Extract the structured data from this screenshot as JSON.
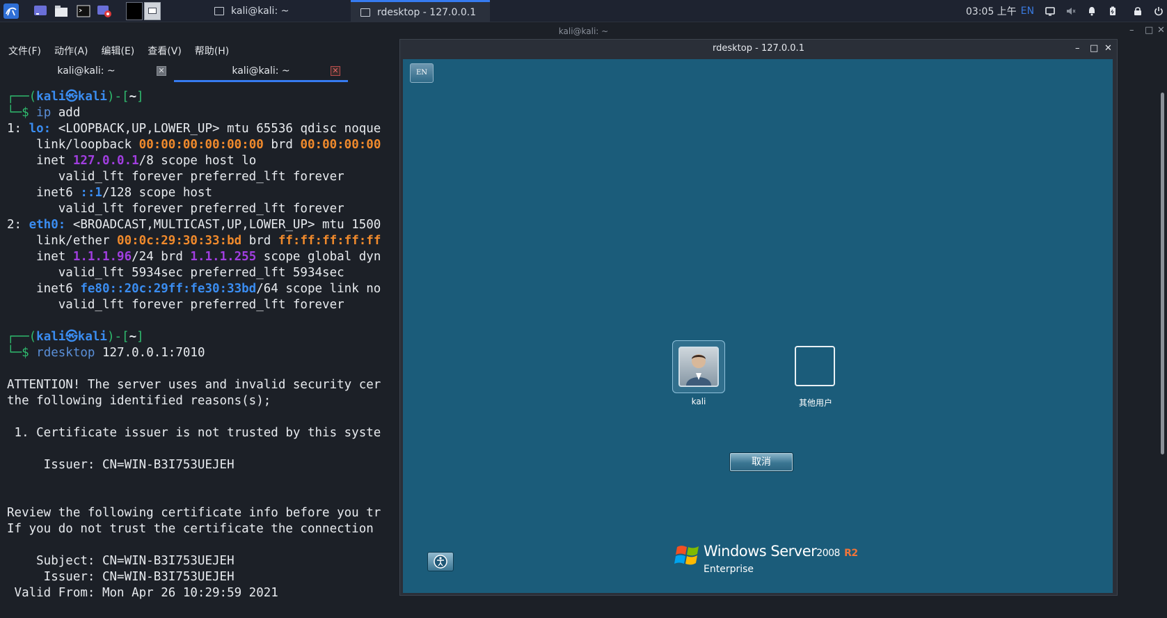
{
  "taskbar": {
    "tasks": [
      {
        "label": "kali@kali: ~"
      },
      {
        "label": "rdesktop - 127.0.0.1"
      }
    ],
    "clock": "03:05 上午",
    "keyboard_layout": "EN"
  },
  "terminal": {
    "window_title": "kali@kali: ~",
    "menu": [
      "文件(F)",
      "动作(A)",
      "编辑(E)",
      "查看(V)",
      "帮助(H)"
    ],
    "tabs": [
      {
        "label": "kali@kali: ~",
        "active": false
      },
      {
        "label": "kali@kali: ~",
        "active": true
      }
    ],
    "lines": {
      "p1_open": "┌──(",
      "p1_user": "kali㉿kali",
      "p1_mid": ")-[",
      "p1_dir": "~",
      "p1_close": "]",
      "p1_prompt": "└─$ ",
      "cmd1_a": "ip",
      "cmd1_b": " add",
      "l1_a": "1: ",
      "l1_if": "lo:",
      "l1_b": " <LOOPBACK,UP,LOWER_UP> mtu 65536 qdisc noque",
      "l2_a": "    link/loopback ",
      "l2_mac": "00:00:00:00:00:00",
      "l2_b": " brd ",
      "l2_brd": "00:00:00:00",
      "l3_a": "    inet ",
      "l3_ip": "127.0.0.1",
      "l3_b": "/8 scope host lo",
      "l4": "       valid_lft forever preferred_lft forever",
      "l5_a": "    inet6 ",
      "l5_ip": "::1",
      "l5_b": "/128 scope host",
      "l6": "       valid_lft forever preferred_lft forever",
      "l7_a": "2: ",
      "l7_if": "eth0:",
      "l7_b": " <BROADCAST,MULTICAST,UP,LOWER_UP> mtu 1500",
      "l8_a": "    link/ether ",
      "l8_mac": "00:0c:29:30:33:bd",
      "l8_b": " brd ",
      "l8_brd": "ff:ff:ff:ff:ff",
      "l9_a": "    inet ",
      "l9_ip": "1.1.1.96",
      "l9_b": "/24 brd ",
      "l9_brd": "1.1.1.255",
      "l9_c": " scope global dyn",
      "l10": "       valid_lft 5934sec preferred_lft 5934sec",
      "l11_a": "    inet6 ",
      "l11_ip": "fe80::20c:29ff:fe30:33bd",
      "l11_b": "/64 scope link no",
      "l12": "       valid_lft forever preferred_lft forever",
      "cmd2_a": "rdesktop",
      "cmd2_b": " 127.0.0.1:7010",
      "att1": "ATTENTION! The server uses and invalid security cer",
      "att2": "the following identified reasons(s);",
      "reason1": " 1. Certificate issuer is not trusted by this syste",
      "issuer1": "     Issuer: CN=WIN-B3I753UEJEH",
      "review1": "Review the following certificate info before you tr",
      "review2": "If you do not trust the certificate the connection",
      "subject": "    Subject: CN=WIN-B3I753UEJEH",
      "issuer2": "     Issuer: CN=WIN-B3I753UEJEH",
      "valid_from": " Valid From: Mon Apr 26 10:29:59 2021"
    }
  },
  "rdesktop": {
    "window_title": "rdesktop - 127.0.0.1",
    "lang_button": "EN",
    "users": [
      {
        "label": "kali"
      },
      {
        "label": "其他用户"
      }
    ],
    "cancel_label": "取消",
    "brand": {
      "windows": "Windows Server",
      "version": "2008",
      "r2": "R2",
      "edition": "Enterprise"
    },
    "colors": {
      "background": "#1b5c7a"
    }
  }
}
